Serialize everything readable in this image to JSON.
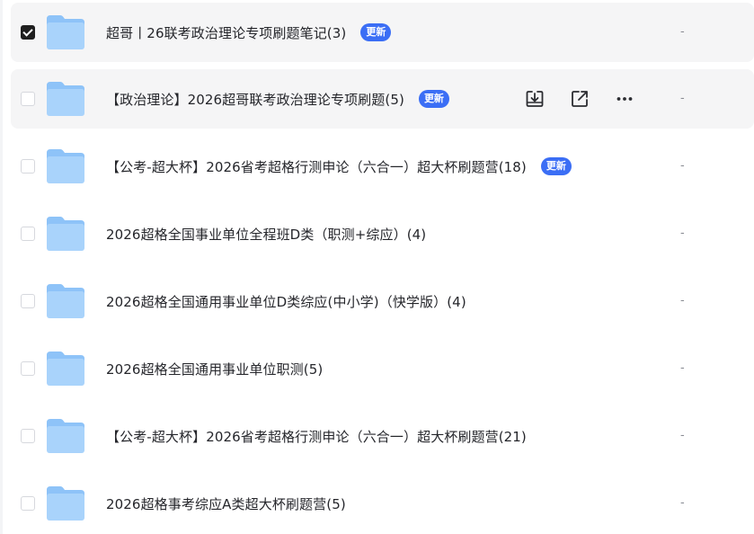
{
  "file_list": {
    "rows": [
      {
        "name": "超哥丨26联考政治理论专项刷题笔记(3)",
        "badge": "更新",
        "selected": true,
        "modified": "-"
      },
      {
        "name": "【政治理论】2026超哥联考政治理论专项刷题(5)",
        "badge": "更新",
        "selected": false,
        "modified": "-"
      },
      {
        "name": "【公考-超大杯】2026省考超格行测申论（六合一）超大杯刷题营(18)",
        "badge": "更新",
        "selected": false,
        "modified": "-"
      },
      {
        "name": "2026超格全国事业单位全程班D类（职测+综应）(4)",
        "badge": "",
        "selected": false,
        "modified": "-"
      },
      {
        "name": "2026超格全国通用事业单位D类综应(中小学)（快学版）(4)",
        "badge": "",
        "selected": false,
        "modified": "-"
      },
      {
        "name": "2026超格全国通用事业单位职测(5)",
        "badge": "",
        "selected": false,
        "modified": "-"
      },
      {
        "name": "【公考-超大杯】2026省考超格行测申论（六合一）超大杯刷题营(21)",
        "badge": "",
        "selected": false,
        "modified": "-"
      },
      {
        "name": "2026超格事考综应A类超大杯刷题营(5)",
        "badge": "",
        "selected": false,
        "modified": "-"
      }
    ],
    "hover_actions": {
      "download_icon": "download-icon",
      "share_icon": "share-icon",
      "more_icon": "more-icon"
    },
    "colors": {
      "badge": "#3b6ef5",
      "folder_light": "#a9d3fb",
      "folder_dark": "#8ec3f8",
      "selected_row": "#f5f5f6"
    }
  }
}
